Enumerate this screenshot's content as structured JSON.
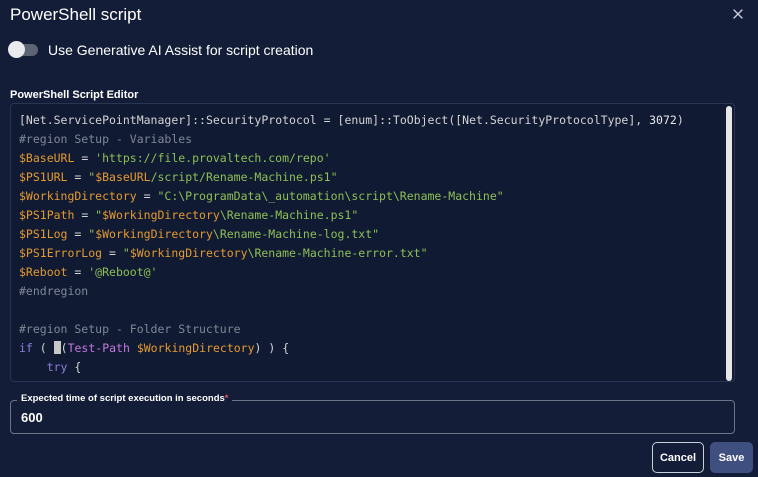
{
  "dialog": {
    "title": "PowerShell script",
    "close_icon": "close-icon"
  },
  "ai_assist": {
    "label": "Use Generative AI Assist for script creation",
    "enabled": false
  },
  "editor": {
    "label": "PowerShell Script Editor",
    "lines": [
      [
        {
          "t": "[Net.ServicePointManager]",
          "c": "type"
        },
        {
          "t": "::",
          "c": "op"
        },
        {
          "t": "SecurityProtocol",
          "c": "type"
        },
        {
          "t": " = ",
          "c": "op"
        },
        {
          "t": "[enum]",
          "c": "type"
        },
        {
          "t": "::",
          "c": "op"
        },
        {
          "t": "ToObject",
          "c": "type"
        },
        {
          "t": "(",
          "c": "op"
        },
        {
          "t": "[Net.SecurityProtocolType]",
          "c": "type"
        },
        {
          "t": ", ",
          "c": "op"
        },
        {
          "t": "3072",
          "c": "num"
        },
        {
          "t": ")",
          "c": "op"
        }
      ],
      [
        {
          "t": "#region Setup - Variables",
          "c": "cmt"
        }
      ],
      [
        {
          "t": "$BaseURL",
          "c": "var"
        },
        {
          "t": " = ",
          "c": "op"
        },
        {
          "t": "'https://file.provaltech.com/repo'",
          "c": "str"
        }
      ],
      [
        {
          "t": "$PS1URL",
          "c": "var"
        },
        {
          "t": " = ",
          "c": "op"
        },
        {
          "t": "\"",
          "c": "str"
        },
        {
          "t": "$BaseURL",
          "c": "var"
        },
        {
          "t": "/script/Rename-Machine.ps1\"",
          "c": "str"
        }
      ],
      [
        {
          "t": "$WorkingDirectory",
          "c": "var"
        },
        {
          "t": " = ",
          "c": "op"
        },
        {
          "t": "\"C:\\ProgramData\\_automation\\script\\Rename-Machine\"",
          "c": "str"
        }
      ],
      [
        {
          "t": "$PS1Path",
          "c": "var"
        },
        {
          "t": " = ",
          "c": "op"
        },
        {
          "t": "\"",
          "c": "str"
        },
        {
          "t": "$WorkingDirectory",
          "c": "var"
        },
        {
          "t": "\\Rename-Machine.ps1\"",
          "c": "str"
        }
      ],
      [
        {
          "t": "$PS1Log",
          "c": "var"
        },
        {
          "t": " = ",
          "c": "op"
        },
        {
          "t": "\"",
          "c": "str"
        },
        {
          "t": "$WorkingDirectory",
          "c": "var"
        },
        {
          "t": "\\Rename-Machine-log.txt\"",
          "c": "str"
        }
      ],
      [
        {
          "t": "$PS1ErrorLog",
          "c": "var"
        },
        {
          "t": " = ",
          "c": "op"
        },
        {
          "t": "\"",
          "c": "str"
        },
        {
          "t": "$WorkingDirectory",
          "c": "var"
        },
        {
          "t": "\\Rename-Machine-error.txt\"",
          "c": "str"
        }
      ],
      [
        {
          "t": "$Reboot",
          "c": "var"
        },
        {
          "t": " = ",
          "c": "op"
        },
        {
          "t": "'@Reboot@'",
          "c": "str"
        }
      ],
      [
        {
          "t": "#endregion",
          "c": "cmt"
        }
      ],
      [],
      [
        {
          "t": "#region Setup - Folder Structure",
          "c": "cmt"
        }
      ],
      [
        {
          "t": "if",
          "c": "kw"
        },
        {
          "t": " ( ",
          "c": "op"
        },
        {
          "t": "",
          "c": "cursor"
        },
        {
          "t": "(",
          "c": "op"
        },
        {
          "t": "Test-Path",
          "c": "cmd"
        },
        {
          "t": " ",
          "c": "op"
        },
        {
          "t": "$WorkingDirectory",
          "c": "var"
        },
        {
          "t": ") ) {",
          "c": "op"
        }
      ],
      [
        {
          "t": "    ",
          "c": "op"
        },
        {
          "t": "try",
          "c": "kw"
        },
        {
          "t": " {",
          "c": "op"
        }
      ]
    ]
  },
  "expected_time": {
    "label": "Expected time of script execution in seconds",
    "required_mark": "*",
    "value": "600"
  },
  "buttons": {
    "cancel": "Cancel",
    "save": "Save"
  },
  "colors": {
    "background": "#131d38",
    "editor_bg": "#101a33",
    "variable": "#e59a2f",
    "string": "#8fbf55",
    "comment": "#7f8796",
    "keyword": "#8a7fdc",
    "save_button": "#3f4f7f",
    "required": "#e0575b"
  }
}
